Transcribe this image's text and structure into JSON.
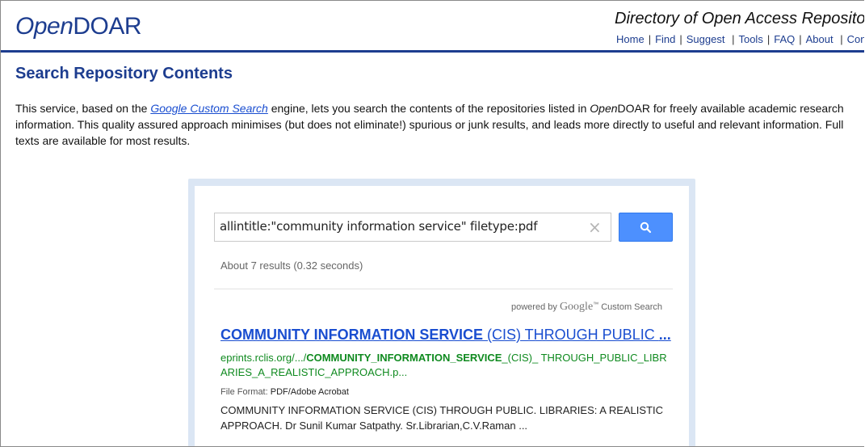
{
  "header": {
    "logo_italic": "Open",
    "logo_rest": "DOAR",
    "tagline": "Directory of Open Access Repositories",
    "nav": [
      "Home",
      "Find",
      "Suggest",
      "Tools",
      "FAQ",
      "About",
      "Contact U"
    ]
  },
  "colors": {
    "brand": "#1d3d8f",
    "link": "#1a4ed0",
    "url_green": "#0f8a1f",
    "search_button": "#4d90fe",
    "widget_frame": "#dbe6f4"
  },
  "main": {
    "title": "Search Repository Contents",
    "intro": {
      "part1": "This service, based on the ",
      "link": "Google Custom Search",
      "part2": " engine, lets you search the contents of the repositories listed in ",
      "open_italic": "Open",
      "part3": "DOAR for freely available academic research information. This quality assured approach minimises (but does not eliminate!) spurious or junk results, and leads more directly to useful and relevant information. Full texts are available for most results."
    }
  },
  "search": {
    "query": "allintitle:\"community information service\" filetype:pdf",
    "clear_icon": "close-icon",
    "button_icon": "search-icon",
    "stats": "About 7 results (0.32 seconds)",
    "branding_prefix": "powered by ",
    "branding_google": "Google",
    "branding_tm": "™",
    "branding_suffix": " Custom Search"
  },
  "results": [
    {
      "title_bold": "COMMUNITY INFORMATION SERVICE",
      "title_rest": " (CIS) THROUGH PUBLIC ",
      "title_ellipsis": "...",
      "url_prefix": "eprints.rclis.org/.../",
      "url_bold": "COMMUNITY_INFORMATION_SERVICE",
      "url_rest": "_(CIS)_ THROUGH_PUBLIC_LIBRARIES_A_REALISTIC_APPROACH.p...",
      "format_label": "File Format: ",
      "format_value": "PDF/Adobe Acrobat",
      "snippet": "COMMUNITY INFORMATION SERVICE (CIS) THROUGH PUBLIC. LIBRARIES: A REALISTIC APPROACH. Dr Sunil Kumar Satpathy. Sr.Librarian,C.V.Raman ..."
    }
  ]
}
